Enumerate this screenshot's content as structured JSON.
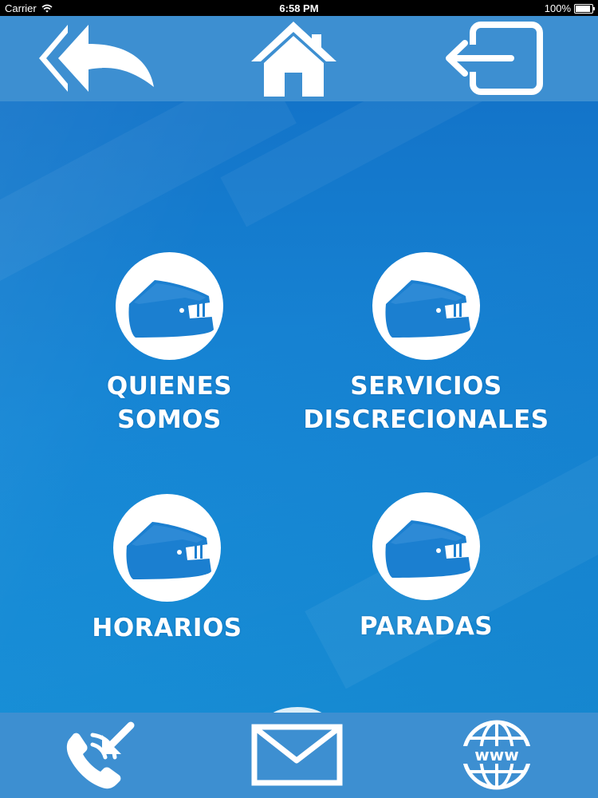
{
  "status_bar": {
    "carrier": "Carrier",
    "time": "6:58 PM",
    "battery": "100%",
    "battery_level": 1.0
  },
  "top_nav": {
    "icons": [
      "back-arrow-icon",
      "home-icon",
      "logout-icon"
    ]
  },
  "menu": [
    {
      "label": "QUIENES\nSOMOS",
      "icon": "bus-icon"
    },
    {
      "label": "SERVICIOS\nDISCRECIONALES",
      "icon": "bus-icon"
    },
    {
      "label": "HORARIOS",
      "icon": "bus-icon"
    },
    {
      "label": "PARADAS",
      "icon": "bus-icon"
    }
  ],
  "bottom_nav": {
    "icons": [
      "phone-icon",
      "mail-icon",
      "www-globe-icon"
    ]
  },
  "colors": {
    "bar": "#3d8fd1",
    "background": "#1a86d4",
    "icon": "#ffffff",
    "bus": "#1b7fd0"
  }
}
